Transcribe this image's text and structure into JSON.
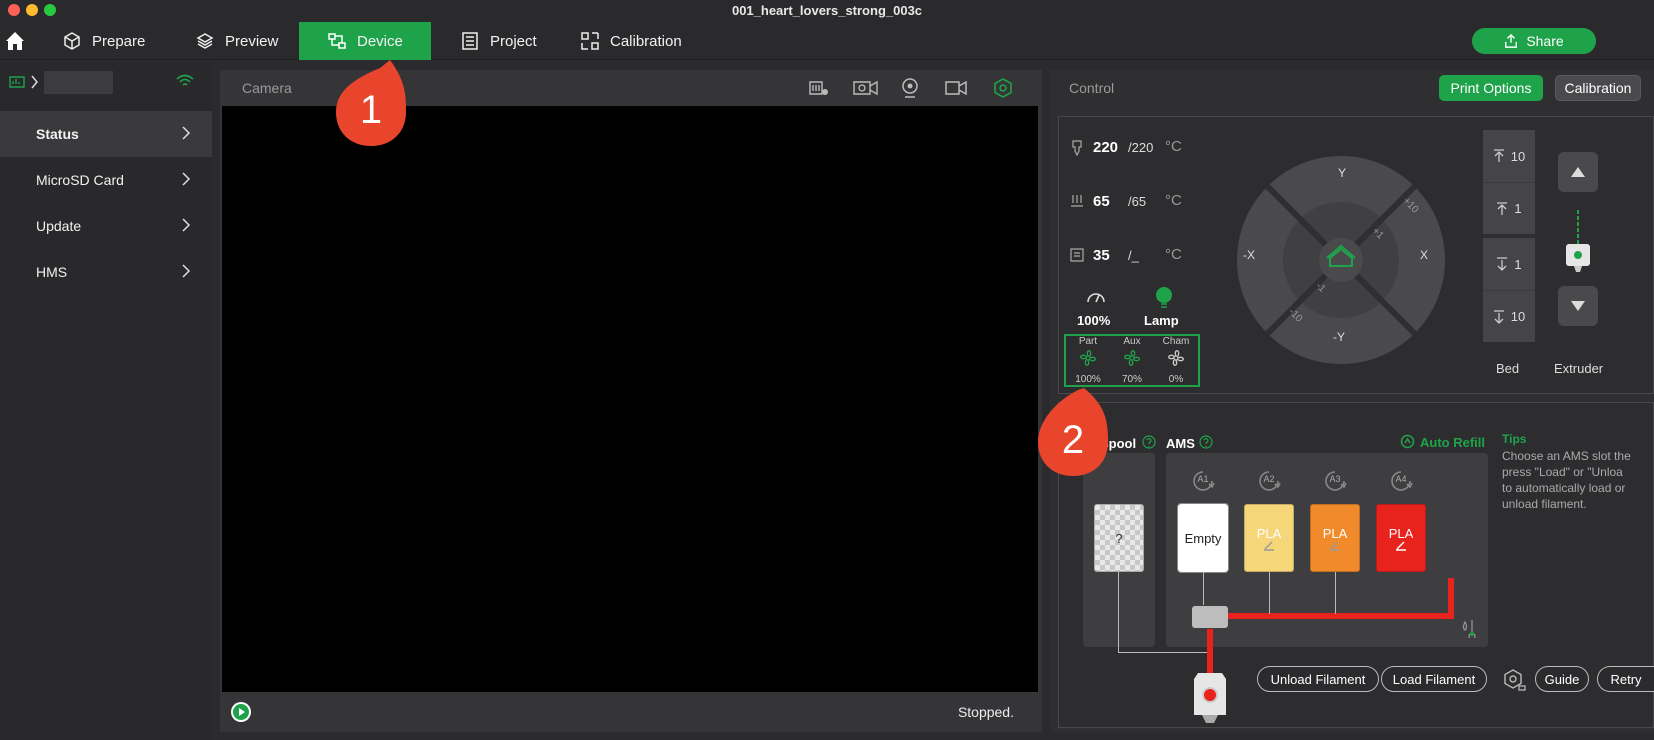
{
  "window": {
    "title": "001_heart_lovers_strong_003c"
  },
  "nav": {
    "tabs": [
      {
        "label": "Prepare"
      },
      {
        "label": "Preview"
      },
      {
        "label": "Device"
      },
      {
        "label": "Project"
      },
      {
        "label": "Calibration"
      }
    ],
    "share_label": "Share"
  },
  "sidebar": {
    "items": [
      {
        "label": "Status"
      },
      {
        "label": "MicroSD Card"
      },
      {
        "label": "Update"
      },
      {
        "label": "HMS"
      }
    ]
  },
  "camera": {
    "title": "Camera",
    "status": "Stopped."
  },
  "control": {
    "title": "Control",
    "print_options_label": "Print Options",
    "calibration_label": "Calibration",
    "nozzle": {
      "current": "220",
      "target": "/220",
      "unit": "°C"
    },
    "bed": {
      "current": "65",
      "target": "/65",
      "unit": "°C"
    },
    "chamber": {
      "current": "35",
      "target": "/_",
      "unit": "°C"
    },
    "speed": "100%",
    "lamp_label": "Lamp",
    "fans": [
      {
        "label": "Part",
        "value": "100%"
      },
      {
        "label": "Aux",
        "value": "70%"
      },
      {
        "label": "Cham",
        "value": "0%"
      }
    ],
    "jog": {
      "y": "Y",
      "neg_y": "-Y",
      "x": "X",
      "neg_x": "-X",
      "p10": "+10",
      "p1": "+1",
      "m1": "-1",
      "m10": "-10"
    },
    "bed_moves": [
      "10",
      "1",
      "1",
      "10"
    ],
    "bed_label": "Bed",
    "extruder_label": "Extruder"
  },
  "ams": {
    "spool_label": "Spool",
    "ams_label": "AMS",
    "auto_refill_label": "Auto Refill",
    "ext_slot": "?",
    "slots": [
      {
        "id": "A1",
        "label": "Empty",
        "color": "#ffffff"
      },
      {
        "id": "A2",
        "label": "PLA",
        "color": "#f5d77a"
      },
      {
        "id": "A3",
        "label": "PLA",
        "color": "#f08a2a"
      },
      {
        "id": "A4",
        "label": "PLA",
        "color": "#e8221c"
      }
    ],
    "tips_title": "Tips",
    "tips_lines": [
      "Choose an AMS slot the",
      "press \"Load\" or \"Unloa",
      "to automatically load or",
      "unload filament."
    ],
    "unload_label": "Unload Filament",
    "load_label": "Load Filament",
    "guide_label": "Guide",
    "retry_label": "Retry"
  },
  "callouts": [
    "1",
    "2"
  ],
  "colors": {
    "accent": "#1fa34a",
    "callout": "#e8452c",
    "filament_path": "#e8221c"
  }
}
